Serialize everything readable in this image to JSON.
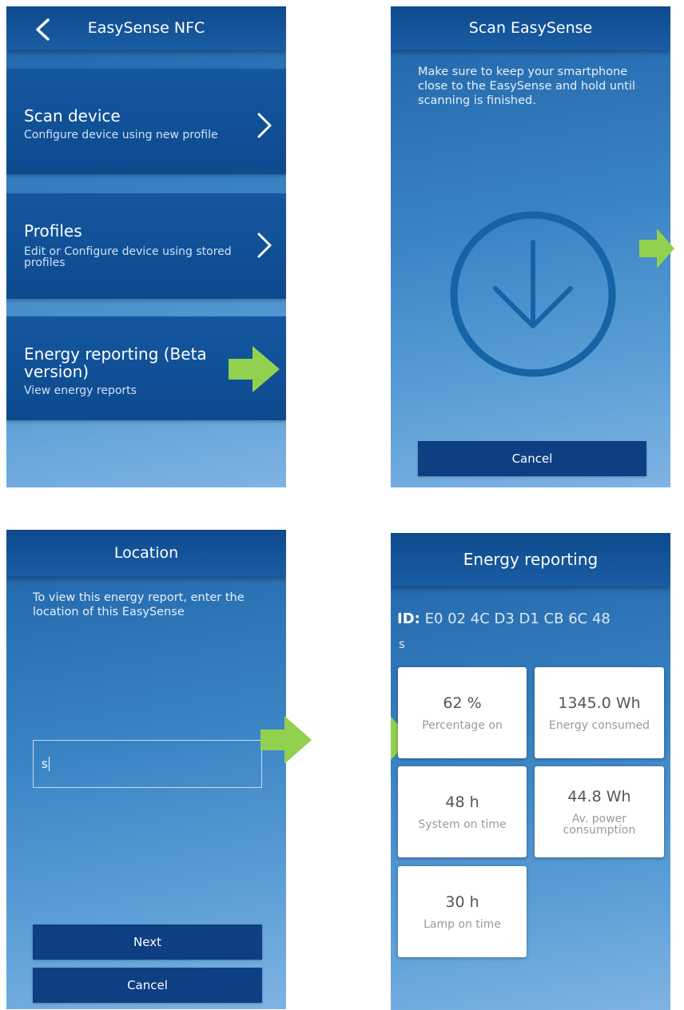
{
  "colors": {
    "header": "#0e4a8e",
    "button": "#0d3f82",
    "arrow": "#92d050",
    "tile": "#ffffff"
  },
  "screen1": {
    "title": "EasySense NFC",
    "back_icon": "chevron-left-icon",
    "items": [
      {
        "title": "Scan device",
        "subtitle": "Configure device using new profile"
      },
      {
        "title": "Profiles",
        "subtitle": "Edit or Configure device using stored profiles"
      },
      {
        "title": "Energy reporting (Beta version)",
        "subtitle": "View energy reports"
      }
    ]
  },
  "screen2": {
    "title": "Scan EasySense",
    "instruction": "Make sure to keep your smartphone close to the EasySense and hold until scanning is finished.",
    "scan_icon": "download-arrow-circle-icon",
    "cancel_label": "Cancel"
  },
  "screen3": {
    "title": "Location",
    "instruction": "To view this energy report, enter the location of this EasySense",
    "location_value": "s",
    "next_label": "Next",
    "cancel_label": "Cancel"
  },
  "screen4": {
    "title": "Energy reporting",
    "id_label": "ID:",
    "id_value": "E0 02 4C D3 D1 CB 6C 48",
    "location": "s",
    "tiles": [
      {
        "value": "62 %",
        "label": "Percentage on"
      },
      {
        "value": "1345.0 Wh",
        "label": "Energy consumed"
      },
      {
        "value": "48 h",
        "label": "System on time"
      },
      {
        "value": "44.8 Wh",
        "label": "Av. power consumption"
      },
      {
        "value": "30 h",
        "label": "Lamp on time"
      }
    ]
  }
}
